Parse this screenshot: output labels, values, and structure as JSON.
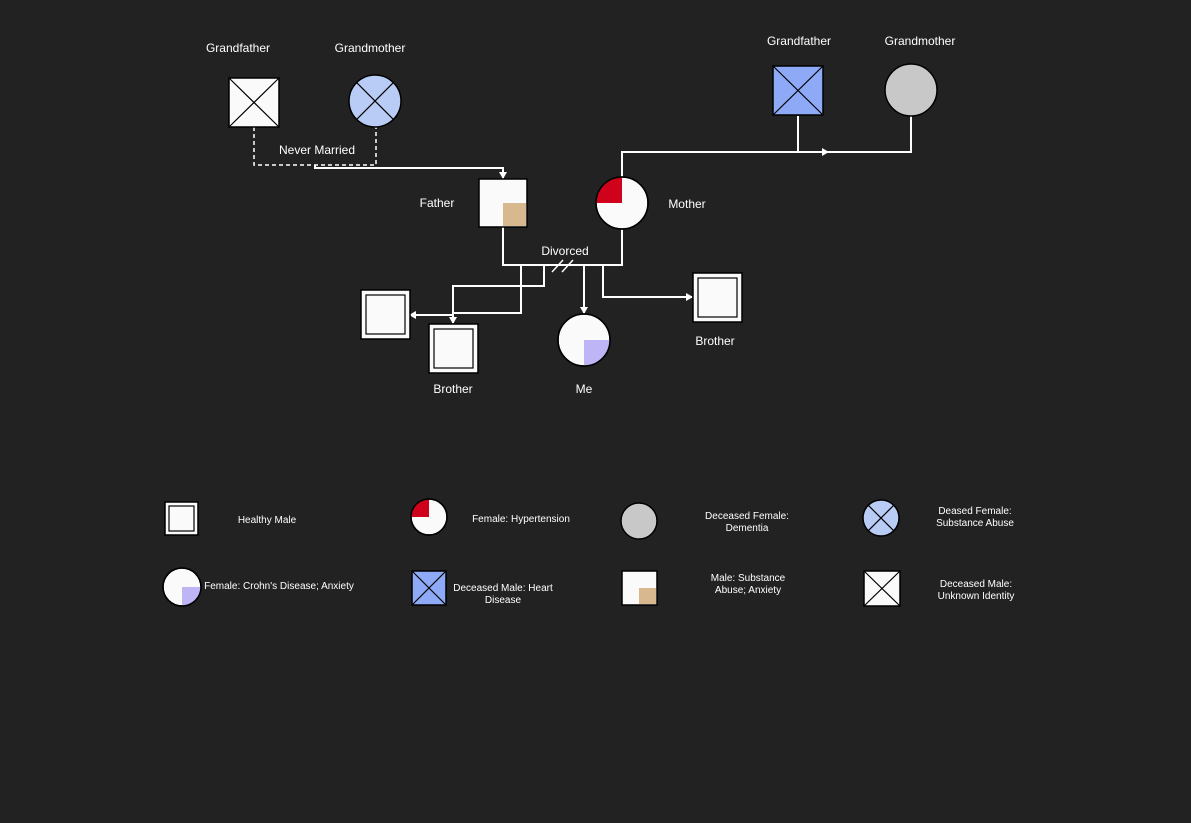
{
  "colors": {
    "background": "#222222",
    "symbol_fill": "#fafafa",
    "hypertension": "#d0021b",
    "crohns_anxiety": "#bdb5f5",
    "substance_anxiety": "#d8b98f",
    "heart_disease": "#8ea9f5",
    "substance_abuse": "#b8ccf5",
    "dementia": "#c8c8c8"
  },
  "people": {
    "paternal_grandfather": "Grandfather",
    "paternal_grandmother": "Grandmother",
    "maternal_grandfather": "Grandfather",
    "maternal_grandmother": "Grandmother",
    "father": "Father",
    "mother": "Mother",
    "brother_left": "Brother",
    "me": "Me",
    "brother_right": "Brother"
  },
  "relationships": {
    "paternal_grandparents": "Never Married",
    "parents": "Divorced"
  },
  "legend": {
    "healthy_male": "Healthy Male",
    "female_hypertension": "Female: Hypertension",
    "deceased_female_dementia": [
      "Deceased Female:",
      "Dementia"
    ],
    "deceased_female_substance": [
      "Deased Female:",
      "Substance Abuse"
    ],
    "female_crohns": "Female: Crohn's Disease; Anxiety",
    "deceased_male_heart": [
      "Deceased Male: Heart",
      "Disease"
    ],
    "male_substance": [
      "Male: Substance",
      "Abuse; Anxiety"
    ],
    "deceased_male_unknown": [
      "Deceased Male:",
      "Unknown Identity"
    ]
  }
}
